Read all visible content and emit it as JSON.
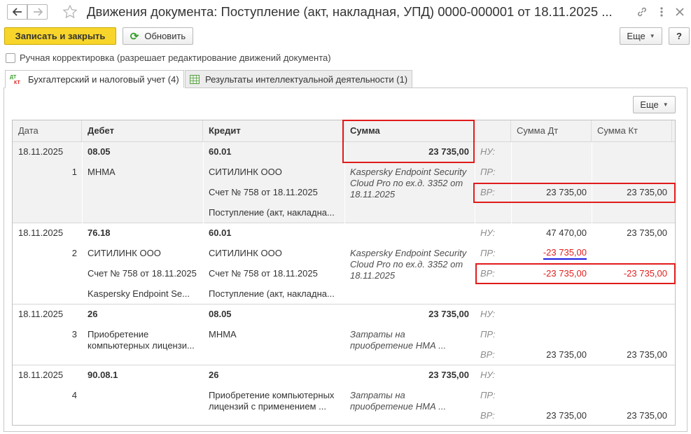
{
  "window": {
    "title": "Движения документа: Поступление (акт, накладная, УПД) 0000-000001 от 18.11.2025 ..."
  },
  "toolbar": {
    "save_close": "Записать и закрыть",
    "refresh": "Обновить",
    "more": "Еще",
    "help": "?"
  },
  "manual_correction": "Ручная корректировка (разрешает редактирование движений документа)",
  "tabs": [
    {
      "label": "Бухгалтерский и налоговый учет (4)"
    },
    {
      "label": "Результаты интеллектуальной деятельности (1)"
    }
  ],
  "grid_more": "Еще",
  "columns": {
    "date": "Дата",
    "debit": "Дебет",
    "credit": "Кредит",
    "sum": "Сумма",
    "blank": "",
    "sum_dt": "Сумма Дт",
    "sum_kt": "Сумма Кт"
  },
  "labels": {
    "nu": "НУ:",
    "pr": "ПР:",
    "vr": "ВР:"
  },
  "rows": [
    {
      "date": "18.11.2025",
      "num": "1",
      "debit": [
        "08.05",
        "МНМА",
        "",
        ""
      ],
      "credit": [
        "60.01",
        "СИТИЛИНК ООО",
        "Счет № 758 от 18.11.2025",
        "Поступление (акт, накладна..."
      ],
      "sum": "23 735,00",
      "content": "Kaspersky Endpoint Security Cloud Pro по ех.д. 3352 от 18.11.2025",
      "nu_dt": "",
      "nu_kt": "",
      "pr_dt": "",
      "pr_kt": "",
      "vr_dt": "23 735,00",
      "vr_kt": "23 735,00"
    },
    {
      "date": "18.11.2025",
      "num": "2",
      "debit": [
        "76.18",
        "СИТИЛИНК ООО",
        "Счет № 758 от 18.11.2025",
        "Kaspersky Endpoint Se..."
      ],
      "credit": [
        "60.01",
        "СИТИЛИНК ООО",
        "Счет № 758 от 18.11.2025",
        "Поступление (акт, накладна..."
      ],
      "sum": "",
      "content": "Kaspersky Endpoint Security Cloud Pro по ех.д. 3352 от 18.11.2025",
      "nu_dt": "47 470,00",
      "nu_kt": "23 735,00",
      "pr_dt": "-23 735,00",
      "pr_kt": "",
      "vr_dt": "-23 735,00",
      "vr_kt": "-23 735,00"
    },
    {
      "date": "18.11.2025",
      "num": "3",
      "debit": [
        "26",
        "Приобретение компьютерных лицензи..."
      ],
      "credit": [
        "08.05",
        "МНМА"
      ],
      "sum": "23 735,00",
      "content": "Затраты на приобретение НМА ...",
      "nu_dt": "",
      "nu_kt": "",
      "pr_dt": "",
      "pr_kt": "",
      "vr_dt": "23 735,00",
      "vr_kt": "23 735,00"
    },
    {
      "date": "18.11.2025",
      "num": "4",
      "debit": [
        "90.08.1",
        ""
      ],
      "credit": [
        "26",
        "Приобретение компьютерных лицензий с применением ..."
      ],
      "sum": "23 735,00",
      "content": "Затраты на приобретение НМА ...",
      "nu_dt": "",
      "nu_kt": "",
      "pr_dt": "",
      "pr_kt": "",
      "vr_dt": "23 735,00",
      "vr_kt": "23 735,00"
    }
  ],
  "colors": {
    "primary_button": "#f7d52a",
    "negative": "#e0201e",
    "highlight_box": "#e21b1b",
    "underline": "#1a1ae8"
  }
}
